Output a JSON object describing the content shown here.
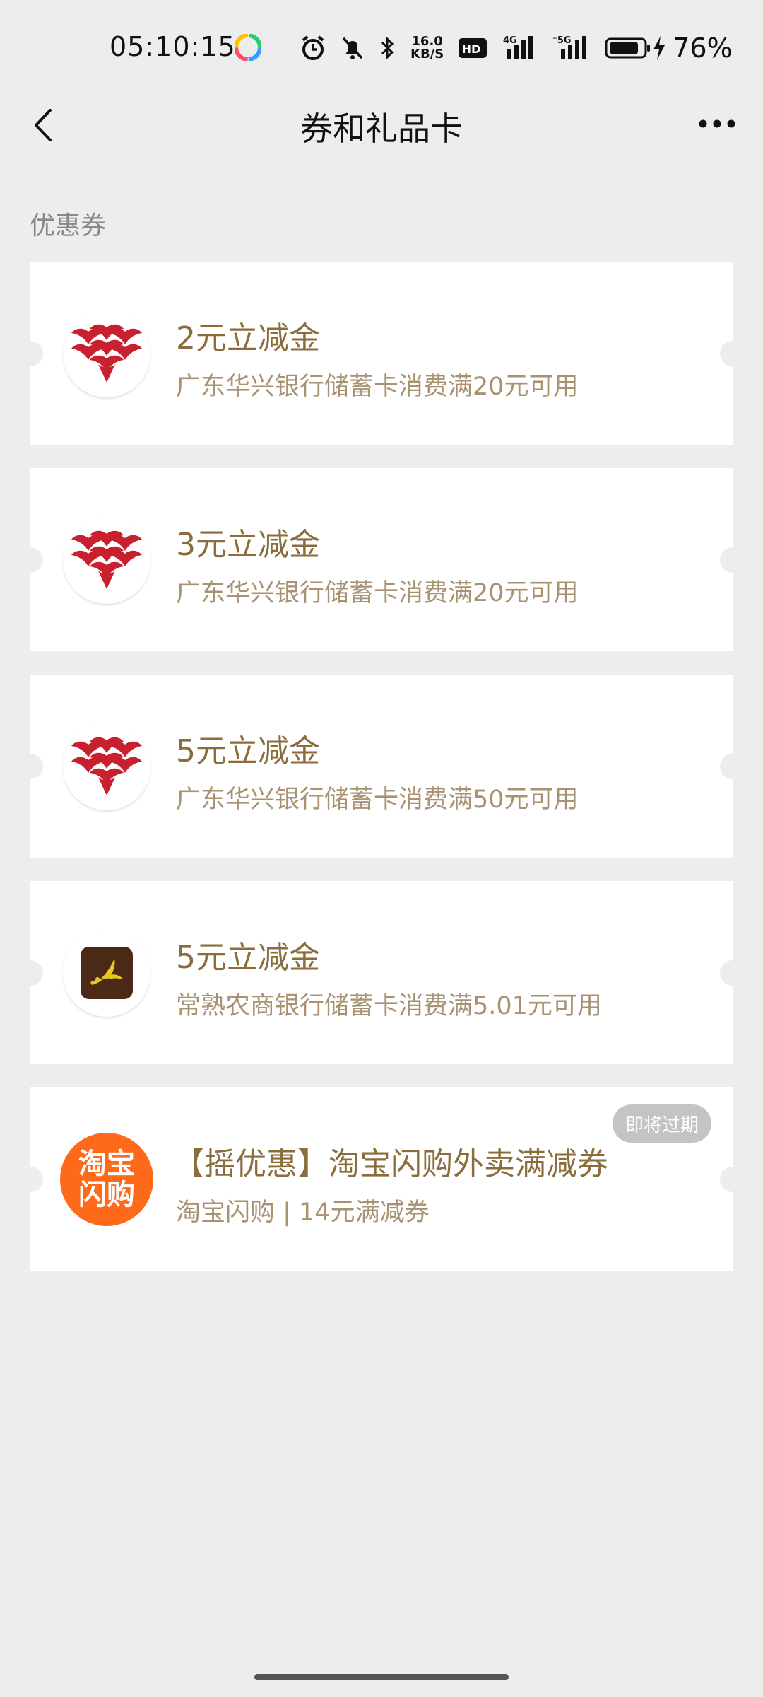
{
  "status_bar": {
    "time": "05:10:15",
    "net_speed_value": "16.0",
    "net_speed_unit": "KB/S",
    "network_4g": "4G",
    "network_5g": "5G",
    "battery_percent": "76%"
  },
  "nav": {
    "title": "券和礼品卡"
  },
  "section_label": "优惠券",
  "coupons": [
    {
      "title": "2元立减金",
      "desc": "广东华兴银行储蓄卡消费满20元可用",
      "logo": "huaxing-bank-logo"
    },
    {
      "title": "3元立减金",
      "desc": "广东华兴银行储蓄卡消费满20元可用",
      "logo": "huaxing-bank-logo"
    },
    {
      "title": "5元立减金",
      "desc": "广东华兴银行储蓄卡消费满50元可用",
      "logo": "huaxing-bank-logo"
    },
    {
      "title": "5元立减金",
      "desc": "常熟农商银行储蓄卡消费满5.01元可用",
      "logo": "changshu-bank-logo"
    },
    {
      "title": "【摇优惠】淘宝闪购外卖满减券",
      "desc": "淘宝闪购 | 14元满减券",
      "logo": "taobao-shangou-logo",
      "badge": "即将过期",
      "logo_text_line1": "淘宝",
      "logo_text_line2": "闪购"
    }
  ],
  "colors": {
    "accent_gold": "#8a6d3b",
    "desc_gold": "#a89272",
    "huaxing_red": "#c8202f",
    "taobao_orange": "#ff6a1a",
    "background": "#ededed"
  }
}
